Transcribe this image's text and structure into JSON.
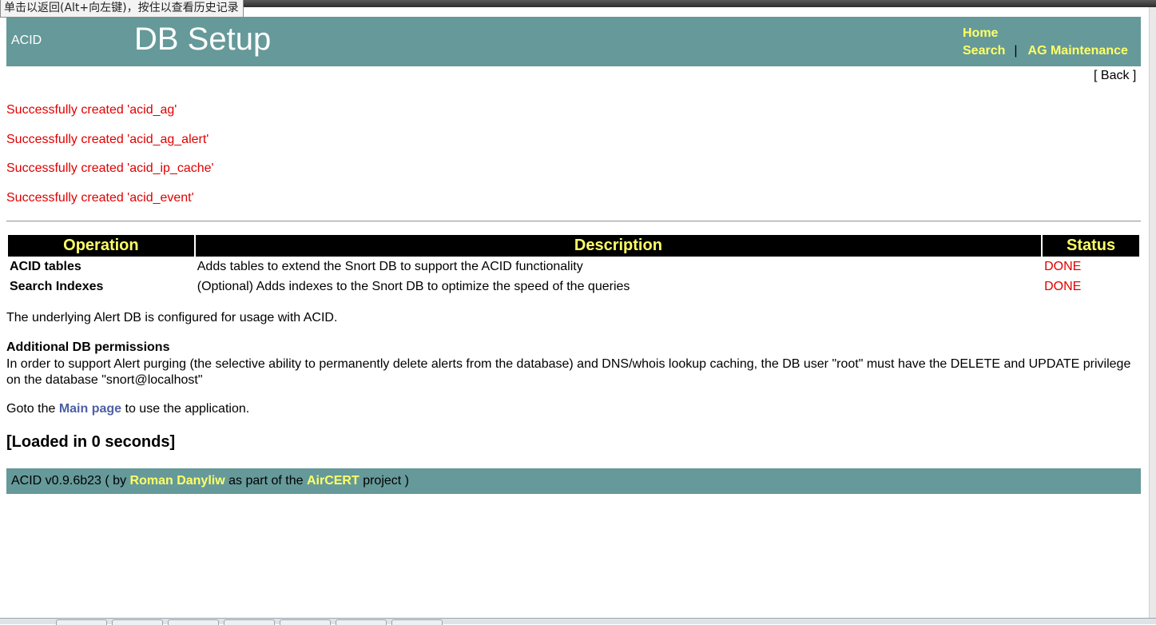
{
  "tooltip": "单击以返回(Alt+向左键)，按住以查看历史记录",
  "header": {
    "brand": "ACID",
    "title": "DB Setup",
    "nav": {
      "home": "Home",
      "search": "Search",
      "separator": "|",
      "maintenance": "AG Maintenance"
    }
  },
  "back": "[ Back ]",
  "messages": [
    "Successfully created 'acid_ag'",
    "Successfully created 'acid_ag_alert'",
    "Successfully created 'acid_ip_cache'",
    "Successfully created 'acid_event'"
  ],
  "table": {
    "headers": [
      "Operation",
      "Description",
      "Status"
    ],
    "rows": [
      {
        "operation": "ACID tables",
        "description": "Adds tables to extend the Snort DB to support the ACID functionality",
        "status": "DONE"
      },
      {
        "operation": "Search Indexes",
        "description": "(Optional) Adds indexes to the Snort DB to optimize the speed of the queries",
        "status": "DONE"
      }
    ]
  },
  "configured_text": "The underlying Alert DB is configured for usage with ACID.",
  "permissions": {
    "heading": "Additional DB permissions",
    "body": "In order to support Alert purging (the selective ability to permanently delete alerts from the database) and DNS/whois lookup caching, the DB user \"root\" must have the DELETE and UPDATE privilege on the database \"snort@localhost\""
  },
  "goto": {
    "prefix": "Goto the",
    "link": "Main page",
    "suffix": "to use the application."
  },
  "loaded": "[Loaded in 0 seconds]",
  "footer": {
    "version": "ACID v0.9.6b23 ( by",
    "author": "Roman Danyliw",
    "middle": "as part of the",
    "project_link": "AirCERT",
    "suffix": "project )"
  },
  "colors": {
    "header_bg": "#669999",
    "link_yellow": "#ffff66",
    "success_red": "#e00000",
    "main_link": "#4d5fa3"
  }
}
